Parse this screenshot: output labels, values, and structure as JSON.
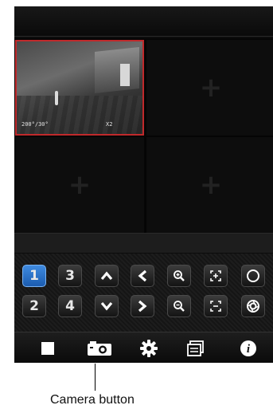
{
  "viewer": {
    "active_feed_osd": {
      "left": "200°/30°",
      "right": "X2"
    },
    "empty_cell_symbol": "+"
  },
  "controls": {
    "channels": [
      "1",
      "3",
      "2",
      "4"
    ],
    "selected_channel": "1",
    "ptz": [
      "pan-up-icon",
      "pan-left-icon",
      "zoom-in-icon",
      "focus-in-icon",
      "iris-open-icon",
      "pan-down-icon",
      "pan-right-icon",
      "zoom-out-icon",
      "focus-out-icon",
      "iris-close-icon"
    ]
  },
  "toolbar": {
    "items": [
      "stop-icon",
      "camera-icon",
      "settings-icon",
      "switch-view-icon",
      "info-icon"
    ],
    "info_label": "i"
  },
  "annotation": {
    "label": "Camera button"
  }
}
